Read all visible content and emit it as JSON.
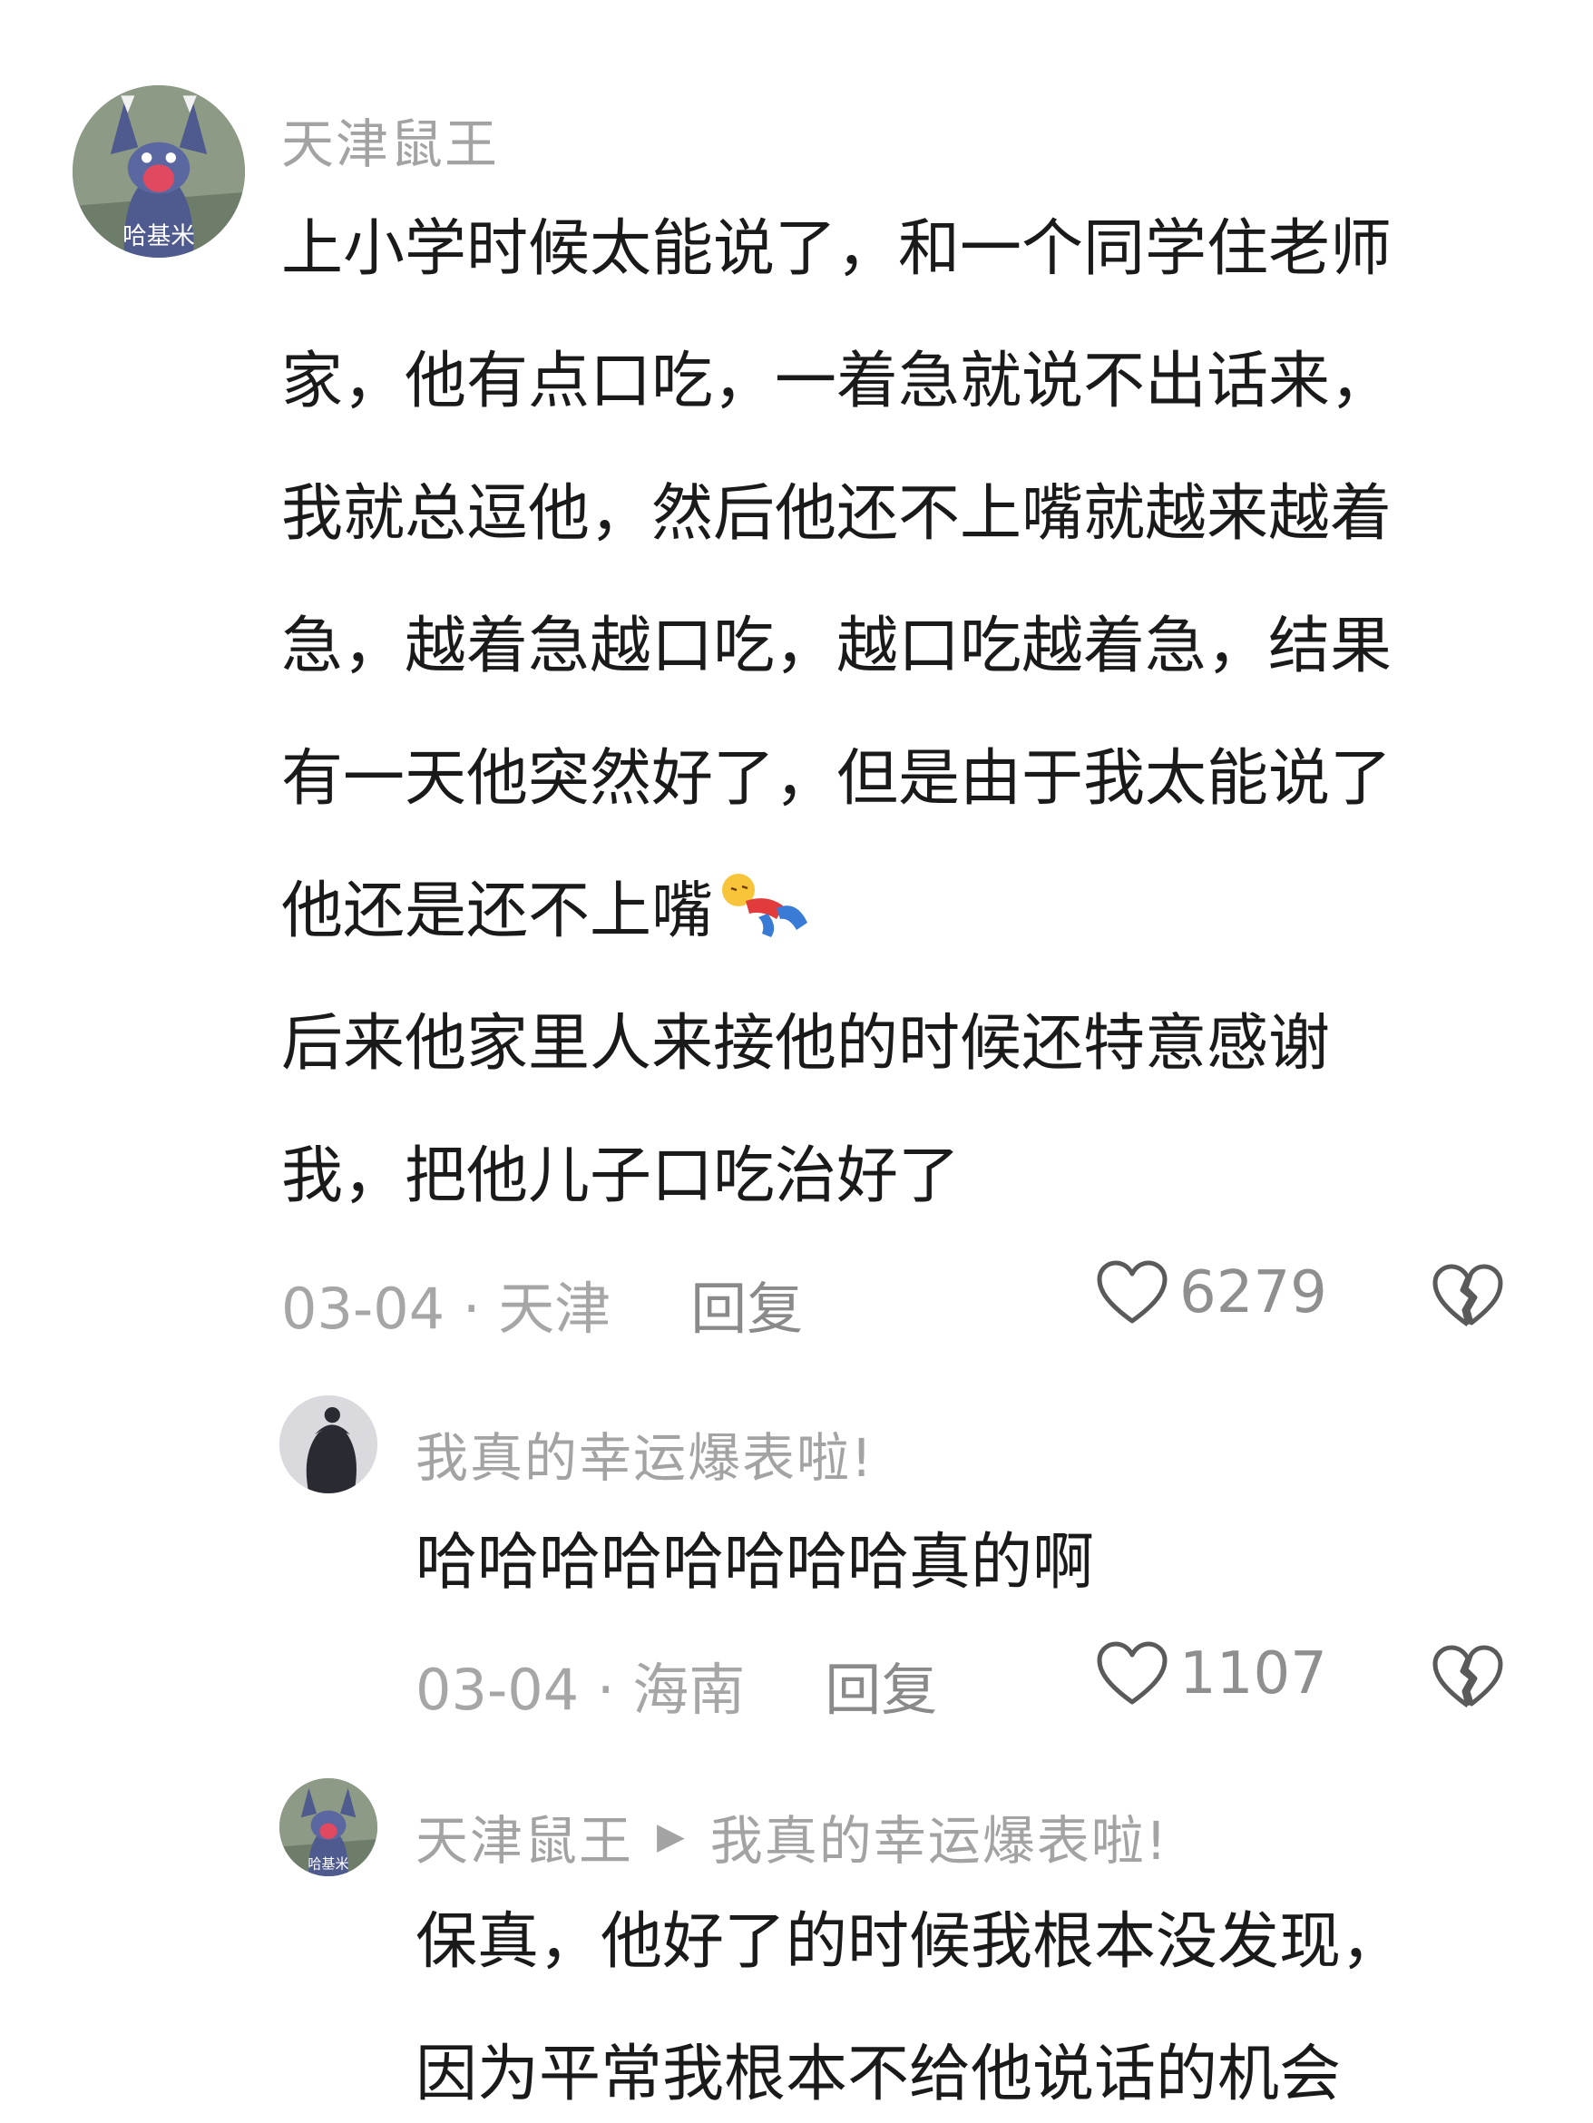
{
  "main_comment": {
    "username": "天津鼠王",
    "avatar_icon": "tom-cat-avatar",
    "avatar_caption": "哈基米",
    "lines": [
      "上小学时候太能说了，和一个同学住老师",
      "家，他有点口吃，一着急就说不出话来，",
      "我就总逗他，然后他还不上嘴就越来越着",
      "急，越着急越口吃，越口吃越着急，结果",
      "有一天他突然好了，但是由于我太能说了",
      "他还是还不上嘴",
      "后来他家里人来接他的时候还特意感谢",
      "我，把他儿子口吃治好了"
    ],
    "emoji": "fainting-emoji",
    "date_location": "03-04 · 天津",
    "reply_label": "回复",
    "likes": "6279"
  },
  "replies": [
    {
      "username": "我真的幸运爆表啦!",
      "avatar_icon": "silhouette-avatar",
      "text": "哈哈哈哈哈哈哈哈真的啊",
      "date_location": "03-04 · 海南",
      "reply_label": "回复",
      "likes": "1107"
    },
    {
      "username": "天津鼠王",
      "avatar_icon": "tom-cat-avatar",
      "avatar_caption": "哈基米",
      "reply_to": "我真的幸运爆表啦!",
      "lines": [
        "保真，他好了的时候我根本没发现，",
        "因为平常我根本不给他说话的机会"
      ]
    }
  ],
  "colors": {
    "text": "#1a1a1a",
    "meta": "#a6a6a6",
    "background": "#ffffff"
  }
}
